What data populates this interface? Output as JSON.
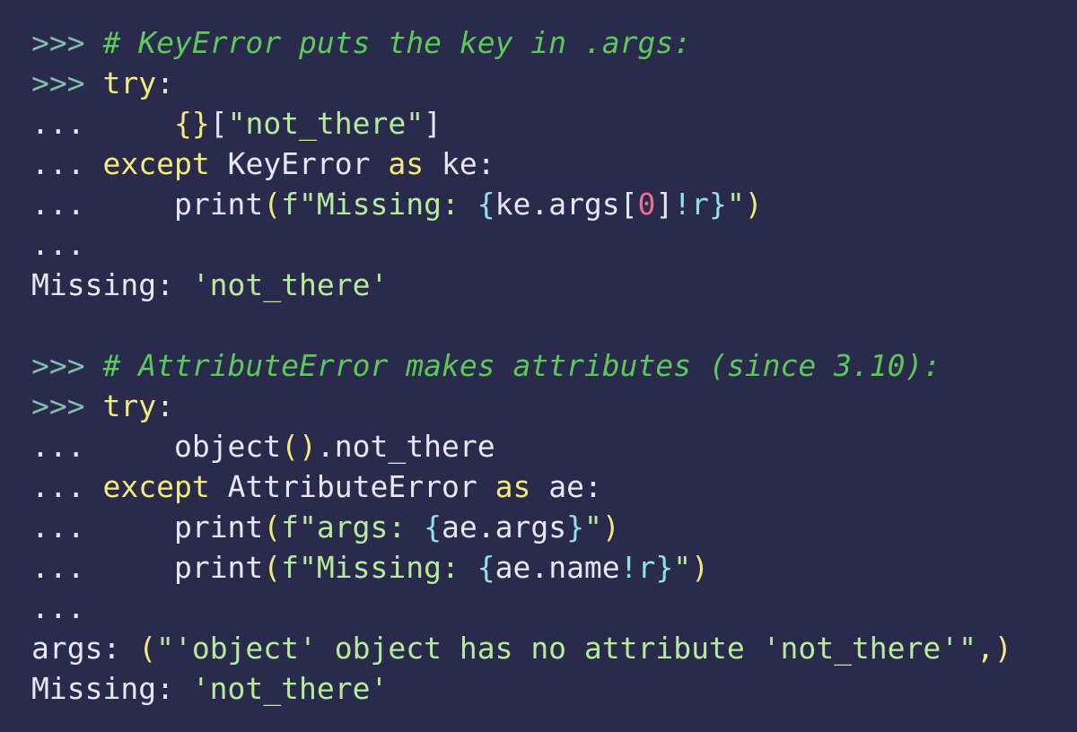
{
  "colors": {
    "background": "#2a2b4c",
    "prompt": "#7fbfa8",
    "comment": "#5cc85a",
    "keyword": "#f2ea7a",
    "plain": "#e6e8f8",
    "string": "#b4ec9c",
    "interpolation": "#8fe0ef",
    "number": "#e8708c"
  },
  "lines": [
    {
      "tokens": [
        {
          "t": "prompt",
          "v": ">>> "
        },
        {
          "t": "comment",
          "v": "# KeyError puts the key in .args:"
        }
      ]
    },
    {
      "tokens": [
        {
          "t": "prompt",
          "v": ">>> "
        },
        {
          "t": "keyword",
          "v": "try"
        },
        {
          "t": "punct",
          "v": ":"
        }
      ]
    },
    {
      "tokens": [
        {
          "t": "cont",
          "v": "...     "
        },
        {
          "t": "brace",
          "v": "{}"
        },
        {
          "t": "punct",
          "v": "["
        },
        {
          "t": "string",
          "v": "\"not_there\""
        },
        {
          "t": "punct",
          "v": "]"
        }
      ]
    },
    {
      "tokens": [
        {
          "t": "cont",
          "v": "... "
        },
        {
          "t": "keyword",
          "v": "except"
        },
        {
          "t": "plain",
          "v": " KeyError "
        },
        {
          "t": "keyword",
          "v": "as"
        },
        {
          "t": "plain",
          "v": " ke:"
        }
      ]
    },
    {
      "tokens": [
        {
          "t": "cont",
          "v": "...     "
        },
        {
          "t": "plain",
          "v": "print"
        },
        {
          "t": "paren",
          "v": "("
        },
        {
          "t": "string",
          "v": "f\"Missing: "
        },
        {
          "t": "interp",
          "v": "{"
        },
        {
          "t": "plain",
          "v": "ke.args["
        },
        {
          "t": "number",
          "v": "0"
        },
        {
          "t": "plain",
          "v": "]"
        },
        {
          "t": "interp",
          "v": "!r}"
        },
        {
          "t": "string",
          "v": "\""
        },
        {
          "t": "paren",
          "v": ")"
        }
      ]
    },
    {
      "tokens": [
        {
          "t": "cont",
          "v": "..."
        }
      ]
    },
    {
      "tokens": [
        {
          "t": "output",
          "v": "Missing: "
        },
        {
          "t": "string",
          "v": "'not_there'"
        }
      ]
    },
    {
      "tokens": []
    },
    {
      "tokens": [
        {
          "t": "prompt",
          "v": ">>> "
        },
        {
          "t": "comment",
          "v": "# AttributeError makes attributes (since 3.10):"
        }
      ]
    },
    {
      "tokens": [
        {
          "t": "prompt",
          "v": ">>> "
        },
        {
          "t": "keyword",
          "v": "try"
        },
        {
          "t": "punct",
          "v": ":"
        }
      ]
    },
    {
      "tokens": [
        {
          "t": "cont",
          "v": "...     "
        },
        {
          "t": "plain",
          "v": "object"
        },
        {
          "t": "paren",
          "v": "()"
        },
        {
          "t": "plain",
          "v": ".not_there"
        }
      ]
    },
    {
      "tokens": [
        {
          "t": "cont",
          "v": "... "
        },
        {
          "t": "keyword",
          "v": "except"
        },
        {
          "t": "plain",
          "v": " AttributeError "
        },
        {
          "t": "keyword",
          "v": "as"
        },
        {
          "t": "plain",
          "v": " ae:"
        }
      ]
    },
    {
      "tokens": [
        {
          "t": "cont",
          "v": "...     "
        },
        {
          "t": "plain",
          "v": "print"
        },
        {
          "t": "paren",
          "v": "("
        },
        {
          "t": "string",
          "v": "f\"args: "
        },
        {
          "t": "interp",
          "v": "{"
        },
        {
          "t": "plain",
          "v": "ae.args"
        },
        {
          "t": "interp",
          "v": "}"
        },
        {
          "t": "string",
          "v": "\""
        },
        {
          "t": "paren",
          "v": ")"
        }
      ]
    },
    {
      "tokens": [
        {
          "t": "cont",
          "v": "...     "
        },
        {
          "t": "plain",
          "v": "print"
        },
        {
          "t": "paren",
          "v": "("
        },
        {
          "t": "string",
          "v": "f\"Missing: "
        },
        {
          "t": "interp",
          "v": "{"
        },
        {
          "t": "plain",
          "v": "ae.name"
        },
        {
          "t": "interp",
          "v": "!r}"
        },
        {
          "t": "string",
          "v": "\""
        },
        {
          "t": "paren",
          "v": ")"
        }
      ]
    },
    {
      "tokens": [
        {
          "t": "cont",
          "v": "..."
        }
      ]
    },
    {
      "tokens": [
        {
          "t": "output",
          "v": "args: "
        },
        {
          "t": "paren",
          "v": "("
        },
        {
          "t": "string",
          "v": "\"'object' object has no attribute 'not_there'\""
        },
        {
          "t": "paren",
          "v": ",)"
        }
      ]
    },
    {
      "tokens": [
        {
          "t": "output",
          "v": "Missing: "
        },
        {
          "t": "string",
          "v": "'not_there'"
        }
      ]
    }
  ]
}
